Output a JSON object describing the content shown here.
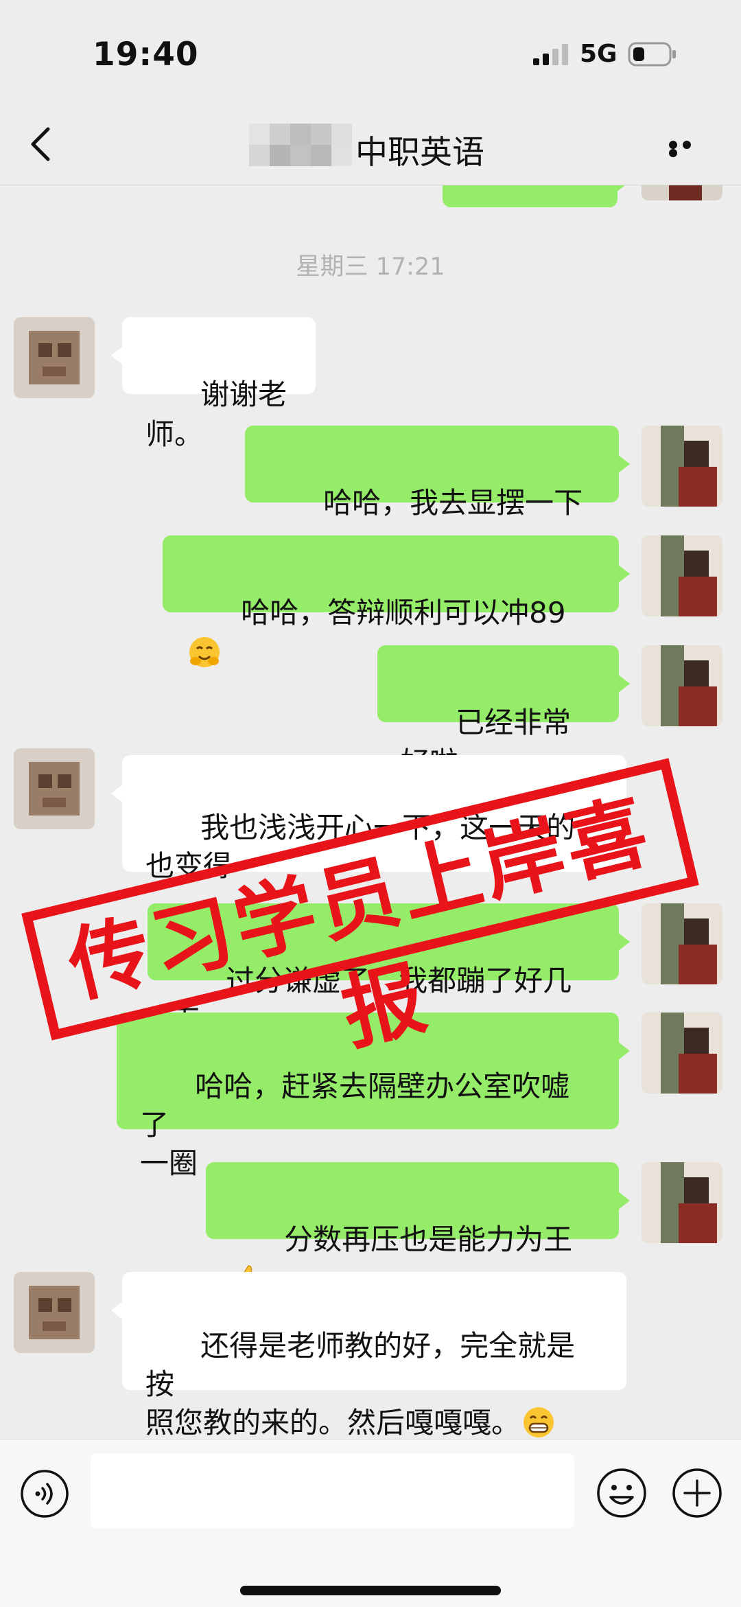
{
  "status_bar": {
    "time": "19:40",
    "network": "5G"
  },
  "nav": {
    "title": "中职英语"
  },
  "chat": {
    "timestamp": "星期三 17:21",
    "messages": [
      {
        "side": "other",
        "text": "谢谢老师。"
      },
      {
        "side": "me",
        "text": "哈哈，我去显摆一下～"
      },
      {
        "side": "me",
        "text": "哈哈，答辩顺利可以冲89",
        "emoji": "hugging-face-emoji"
      },
      {
        "side": "me",
        "text": "已经非常好啦"
      },
      {
        "side": "other",
        "text": "我也浅浅开心一下，这一天的\n也变得"
      },
      {
        "side": "me",
        "text": "过分谦虚了，我都蹦了好几下"
      },
      {
        "side": "me",
        "text": "哈哈，赶紧去隔壁办公室吹嘘了\n一圈"
      },
      {
        "side": "me",
        "text": "分数再压也是能力为王",
        "emoji": "thumbs-up-emoji"
      },
      {
        "side": "other",
        "text": "还得是老师教的好，完全就是按\n照您教的来的。然后嘎嘎嘎。",
        "emoji": "grinning-face-emoji"
      }
    ]
  },
  "stamp": {
    "text": "传习学员上岸喜报",
    "color": "#e8141a"
  },
  "colors": {
    "my_bubble": "#95ec69",
    "other_bubble": "#ffffff",
    "background": "#ededed"
  }
}
